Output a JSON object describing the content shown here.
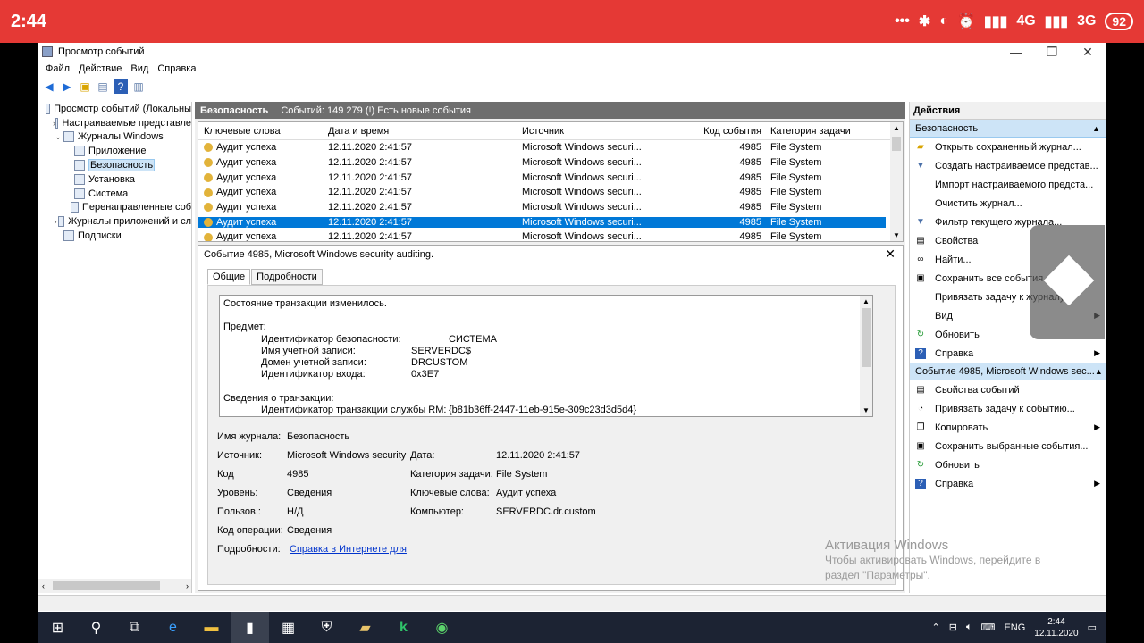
{
  "status_bar": {
    "time": "2:44",
    "signal1": "4G",
    "signal2": "3G",
    "battery": "92"
  },
  "window": {
    "title": "Просмотр событий",
    "menu": [
      "Файл",
      "Действие",
      "Вид",
      "Справка"
    ]
  },
  "tree": [
    {
      "label": "Просмотр событий (Локальны",
      "exp": "",
      "indent": 0
    },
    {
      "label": "Настраиваемые представле",
      "exp": ">",
      "indent": 1
    },
    {
      "label": "Журналы Windows",
      "exp": "v",
      "indent": 1
    },
    {
      "label": "Приложение",
      "exp": "",
      "indent": 2
    },
    {
      "label": "Безопасность",
      "exp": "",
      "indent": 2,
      "selected": true
    },
    {
      "label": "Установка",
      "exp": "",
      "indent": 2
    },
    {
      "label": "Система",
      "exp": "",
      "indent": 2
    },
    {
      "label": "Перенаправленные соб",
      "exp": "",
      "indent": 2
    },
    {
      "label": "Журналы приложений и сл",
      "exp": ">",
      "indent": 1
    },
    {
      "label": "Подписки",
      "exp": "",
      "indent": 1
    }
  ],
  "log_header": {
    "title": "Безопасность",
    "info": "Событий: 149 279 (!) Есть новые события"
  },
  "grid": {
    "columns": [
      "Ключевые слова",
      "Дата и время",
      "Источник",
      "Код события",
      "Категория задачи"
    ],
    "rows": [
      [
        "Аудит успеха",
        "12.11.2020 2:41:57",
        "Microsoft Windows securi...",
        "4985",
        "File System"
      ],
      [
        "Аудит успеха",
        "12.11.2020 2:41:57",
        "Microsoft Windows securi...",
        "4985",
        "File System"
      ],
      [
        "Аудит успеха",
        "12.11.2020 2:41:57",
        "Microsoft Windows securi...",
        "4985",
        "File System"
      ],
      [
        "Аудит успеха",
        "12.11.2020 2:41:57",
        "Microsoft Windows securi...",
        "4985",
        "File System"
      ],
      [
        "Аудит успеха",
        "12.11.2020 2:41:57",
        "Microsoft Windows securi...",
        "4985",
        "File System"
      ],
      [
        "Аудит успеха",
        "12.11.2020 2:41:57",
        "Microsoft Windows securi...",
        "4985",
        "File System"
      ],
      [
        "Аудит успеха",
        "12.11.2020 2:41:57",
        "Microsoft Windows securi...",
        "4985",
        "File System"
      ]
    ],
    "selected_index": 5
  },
  "detail": {
    "title": "Событие 4985, Microsoft Windows security auditing.",
    "tabs": [
      "Общие",
      "Подробности"
    ],
    "description": {
      "line1": "Состояние транзакции изменилось.",
      "subject_header": "Предмет:",
      "subject": [
        {
          "k": "Идентификатор безопасности:",
          "v": "СИСТЕМА"
        },
        {
          "k": "Имя учетной записи:",
          "v": "SERVERDC$"
        },
        {
          "k": "Домен учетной записи:",
          "v": "DRCUSTOM"
        },
        {
          "k": "Идентификатор входа:",
          "v": "0x3E7"
        }
      ],
      "tx_header": "Сведения о транзакции:",
      "tx": [
        {
          "k": "Идентификатор транзакции службы RM:",
          "v": "{b81b36ff-2447-11eb-915e-309c23d3d5d4}"
        }
      ]
    },
    "props": {
      "log_name_label": "Имя журнала:",
      "log_name": "Безопасность",
      "source_label": "Источник:",
      "source": "Microsoft Windows security",
      "date_label": "Дата:",
      "date": "12.11.2020 2:41:57",
      "code_label": "Код",
      "code": "4985",
      "task_label": "Категория задачи:",
      "task": "File System",
      "level_label": "Уровень:",
      "level": "Сведения",
      "keywords_label": "Ключевые слова:",
      "keywords": "Аудит успеха",
      "user_label": "Пользов.:",
      "user": "Н/Д",
      "computer_label": "Компьютер:",
      "computer": "SERVERDC.dr.custom",
      "opcode_label": "Код операции:",
      "opcode": "Сведения",
      "more_label": "Подробности:",
      "more_link": "Справка в Интернете для"
    }
  },
  "actions": {
    "title": "Действия",
    "section1": "Безопасность",
    "items1": [
      {
        "label": "Открыть сохраненный журнал...",
        "icon": "folder-icon"
      },
      {
        "label": "Создать настраиваемое представ...",
        "icon": "filter-icon"
      },
      {
        "label": "Импорт настраиваемого предста...",
        "icon": ""
      },
      {
        "label": "Очистить журнал...",
        "icon": ""
      },
      {
        "label": "Фильтр текущего журнала...",
        "icon": "filter-icon"
      },
      {
        "label": "Свойства",
        "icon": "properties-icon"
      },
      {
        "label": "Найти...",
        "icon": "binoculars-icon"
      },
      {
        "label": "Сохранить все события ка...",
        "icon": "save-icon"
      },
      {
        "label": "Привязать задачу к журналу...",
        "icon": ""
      },
      {
        "label": "Вид",
        "icon": "",
        "sub": true
      },
      {
        "label": "Обновить",
        "icon": "refresh-icon"
      },
      {
        "label": "Справка",
        "icon": "help-icon",
        "sub": true
      }
    ],
    "section2": "Событие 4985, Microsoft Windows sec...",
    "items2": [
      {
        "label": "Свойства событий",
        "icon": "properties-icon"
      },
      {
        "label": "Привязать задачу к событию...",
        "icon": "task-icon"
      },
      {
        "label": "Копировать",
        "icon": "copy-icon",
        "sub": true
      },
      {
        "label": "Сохранить выбранные события...",
        "icon": "save-icon"
      },
      {
        "label": "Обновить",
        "icon": "refresh-icon"
      },
      {
        "label": "Справка",
        "icon": "help-icon",
        "sub": true
      }
    ]
  },
  "watermark": {
    "line1": "Активация Windows",
    "line2": "Чтобы активировать Windows, перейдите в раздел \"Параметры\"."
  },
  "taskbar": {
    "lang": "ENG",
    "time": "2:44",
    "date": "12.11.2020"
  }
}
